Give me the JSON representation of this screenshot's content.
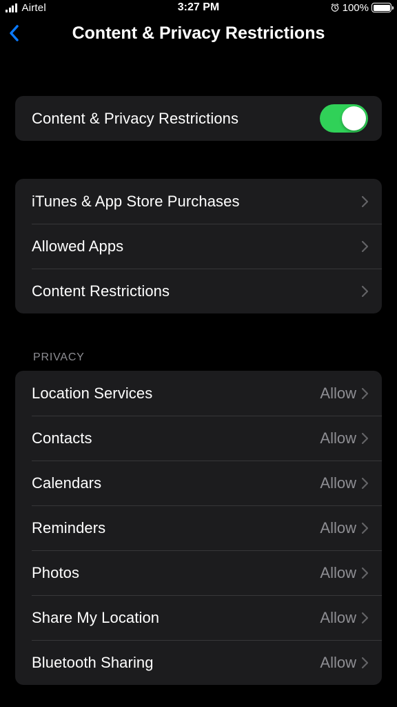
{
  "status_bar": {
    "carrier": "Airtel",
    "time": "3:27 PM",
    "battery_pct": "100%"
  },
  "nav": {
    "title": "Content & Privacy Restrictions"
  },
  "main_toggle": {
    "label": "Content & Privacy Restrictions",
    "enabled": true
  },
  "settings_group": [
    {
      "label": "iTunes & App Store Purchases"
    },
    {
      "label": "Allowed Apps"
    },
    {
      "label": "Content Restrictions"
    }
  ],
  "privacy": {
    "header": "PRIVACY",
    "items": [
      {
        "label": "Location Services",
        "value": "Allow"
      },
      {
        "label": "Contacts",
        "value": "Allow"
      },
      {
        "label": "Calendars",
        "value": "Allow"
      },
      {
        "label": "Reminders",
        "value": "Allow"
      },
      {
        "label": "Photos",
        "value": "Allow"
      },
      {
        "label": "Share My Location",
        "value": "Allow"
      },
      {
        "label": "Bluetooth Sharing",
        "value": "Allow"
      }
    ]
  }
}
